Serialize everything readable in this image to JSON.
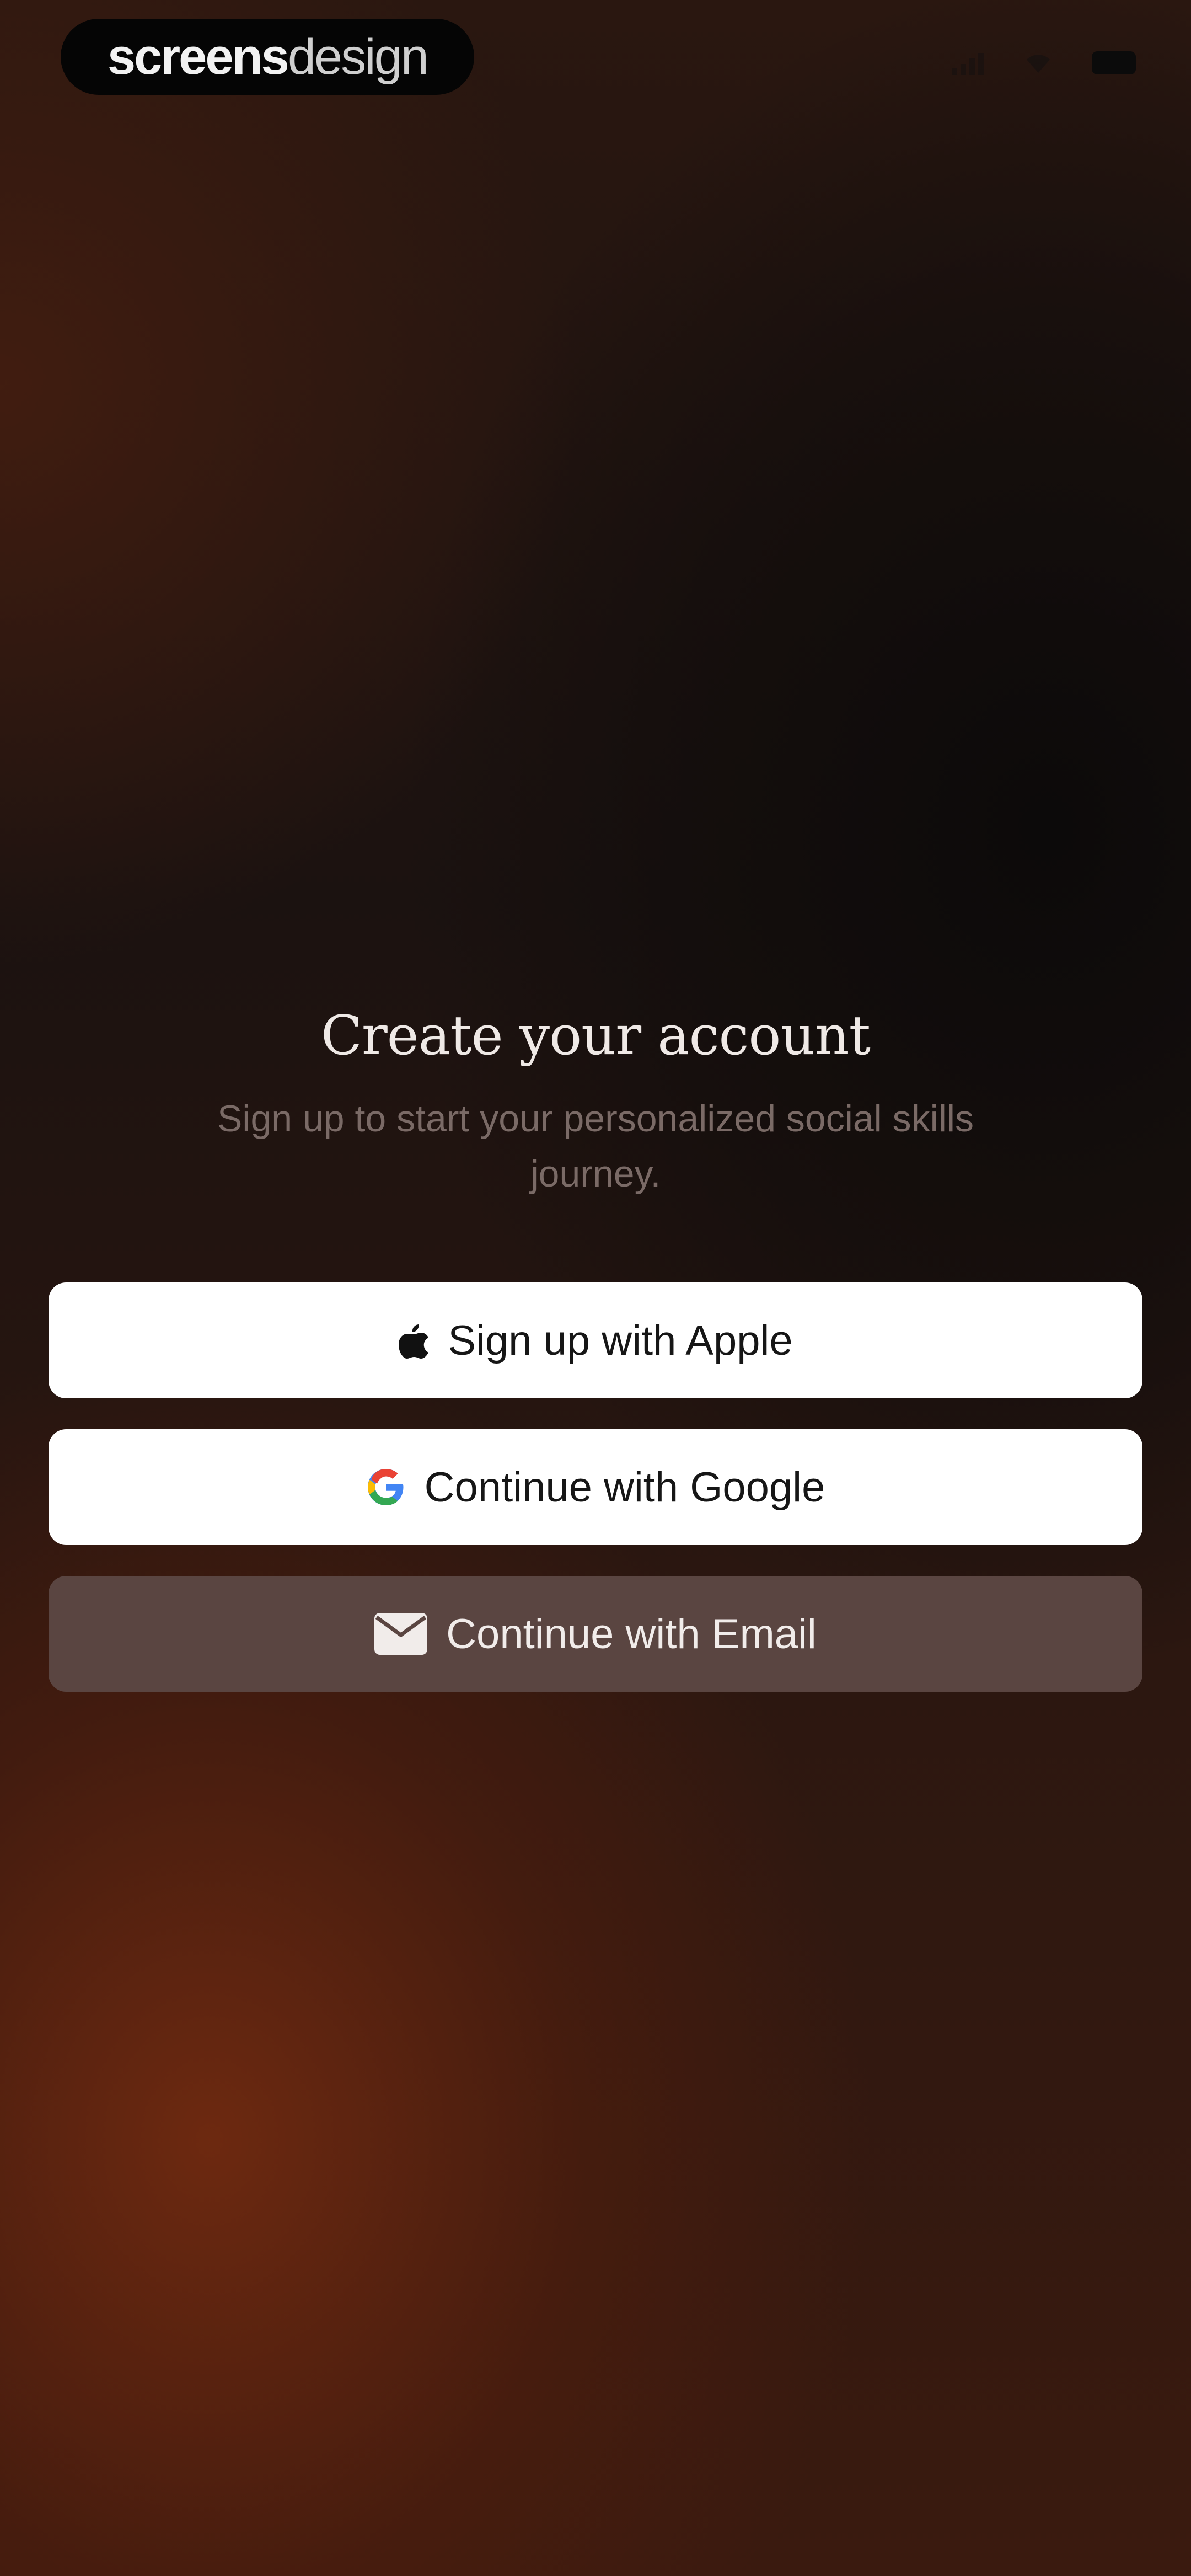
{
  "status_bar": {
    "brand_bold": "screens",
    "brand_light": "design",
    "icons": [
      "signal-icon",
      "wifi-icon",
      "battery-icon"
    ]
  },
  "auth": {
    "title": "Create your account",
    "subtitle": "Sign up to start your personalized social skills journey.",
    "buttons": [
      {
        "label": "Sign up with Apple",
        "icon": "apple-icon"
      },
      {
        "label": "Continue with Google",
        "icon": "google-icon"
      },
      {
        "label": "Continue with Email",
        "icon": "mail-icon"
      }
    ]
  },
  "colors": {
    "background_dark": "#1b1210",
    "background_warm": "#702a10",
    "light_button": "#ffffff",
    "email_button": "#5a4541",
    "title_text": "#efe9e6",
    "subtitle_text": "#7a6a66"
  }
}
